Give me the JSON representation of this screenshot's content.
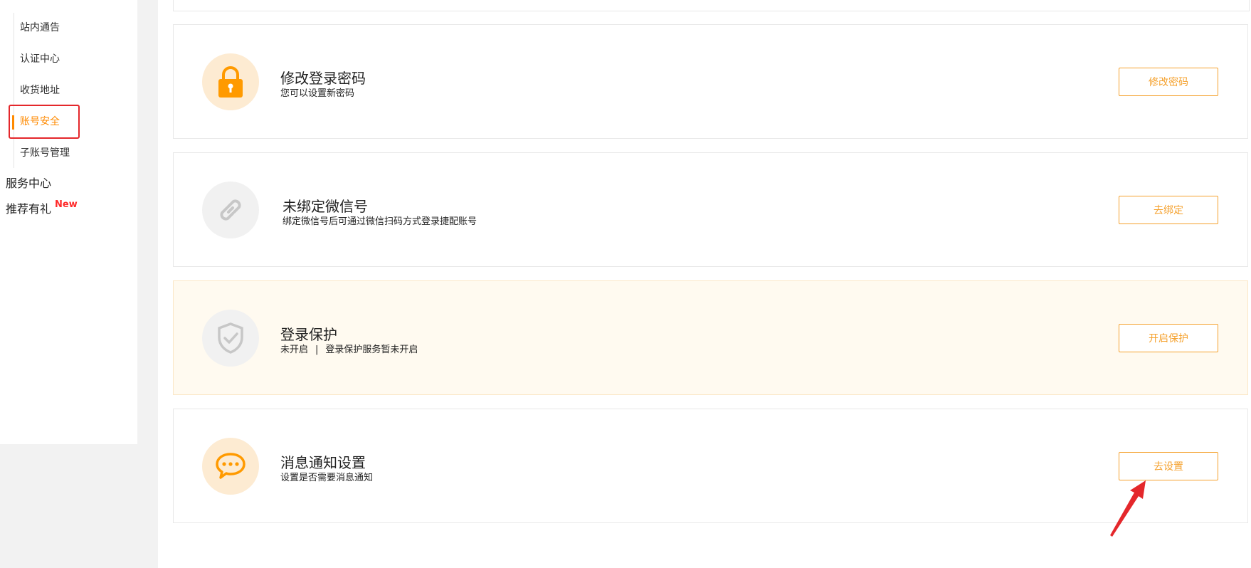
{
  "sidebar": {
    "sub_items": [
      {
        "label": "站内通告"
      },
      {
        "label": "认证中心"
      },
      {
        "label": "收货地址"
      },
      {
        "label": "账号安全"
      },
      {
        "label": "子账号管理"
      }
    ],
    "groups": [
      {
        "label": "服务中心"
      },
      {
        "label": "推荐有礼"
      }
    ],
    "new_badge": "New"
  },
  "cards": [
    {
      "title": "修改登录密码",
      "desc": "您可以设置新密码",
      "button": "修改密码",
      "icon": "lock-icon"
    },
    {
      "title": "未绑定微信号",
      "desc": "绑定微信号后可通过微信扫码方式登录捷配账号",
      "button": "去绑定",
      "icon": "link-icon"
    },
    {
      "title": "登录保护",
      "status": "未开启",
      "separator": "|",
      "desc": "登录保护服务暂未开启",
      "button": "开启保护",
      "icon": "shield-check-icon"
    },
    {
      "title": "消息通知设置",
      "desc": "设置是否需要消息通知",
      "button": "去设置",
      "icon": "chat-bubble-icon"
    }
  ],
  "colors": {
    "accent": "#ff8a00",
    "button": "#f5a12d",
    "annotation": "#e4272b"
  }
}
